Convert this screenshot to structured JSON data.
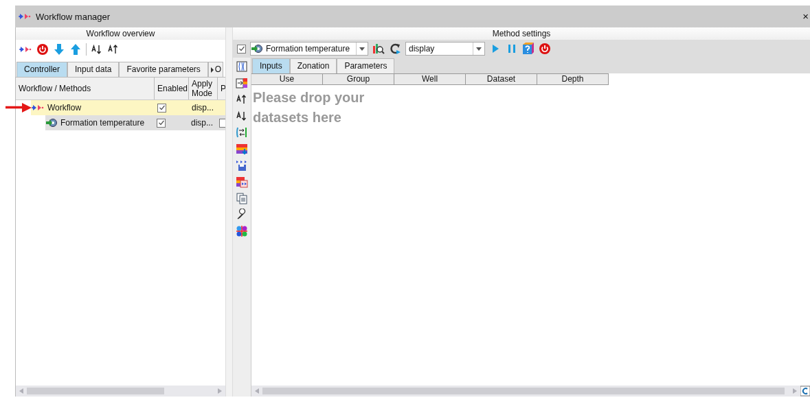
{
  "window": {
    "title": "Workflow manager",
    "close": "×"
  },
  "overview": {
    "title": "Workflow overview",
    "tabs": [
      {
        "label": "Controller",
        "selected": true
      },
      {
        "label": "Input data",
        "selected": false
      },
      {
        "label": "Favorite parameters",
        "selected": false
      },
      {
        "label": "O",
        "selected": false
      }
    ],
    "columns": [
      "Workflow / Methods",
      "Enabled",
      "Apply Mode",
      "P"
    ],
    "rows": [
      {
        "kind": "workflow",
        "name": "Workflow",
        "enabled": true,
        "mode": "disp...",
        "selected": true,
        "children": [
          {
            "kind": "method",
            "name": "Formation temperature",
            "enabled": true,
            "mode": "disp...",
            "selected": false,
            "flag": false
          }
        ]
      }
    ]
  },
  "method": {
    "title": "Method settings",
    "enabled": true,
    "method": "Formation temperature",
    "mode": "display",
    "tabs": [
      {
        "label": "Inputs",
        "selected": true
      },
      {
        "label": "Zonation",
        "selected": false
      },
      {
        "label": "Parameters",
        "selected": false
      }
    ],
    "columns": [
      "Use",
      "Group",
      "Well",
      "Dataset",
      "Depth"
    ],
    "empty": "Please drop your datasets here"
  }
}
